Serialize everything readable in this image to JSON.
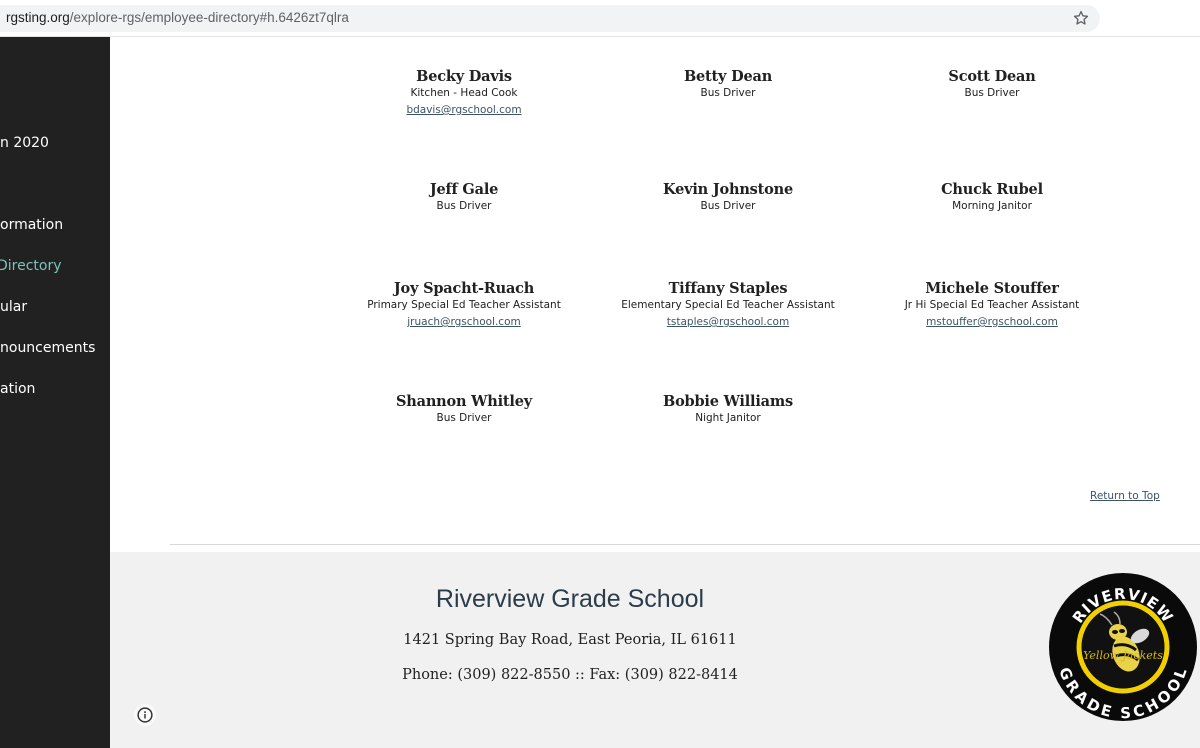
{
  "browser": {
    "url_host": "rgsting.org",
    "url_path": "/explore-rgs/employee-directory#h.6426zt7qlra",
    "bookmark_icon": "star-icon"
  },
  "sidebar": {
    "items": [
      {
        "label": "n 2020",
        "active": false
      },
      {
        "label": "ormation",
        "active": false
      },
      {
        "label": "Directory",
        "active": true
      },
      {
        "label": "ular",
        "active": false
      },
      {
        "label": "nouncements",
        "active": false
      },
      {
        "label": "ation",
        "active": false
      }
    ]
  },
  "directory": {
    "people": [
      {
        "name": "Becky Davis",
        "role": "Kitchen - Head Cook",
        "email": "bdavis@rgschool.com"
      },
      {
        "name": "Betty Dean",
        "role": "Bus Driver",
        "email": ""
      },
      {
        "name": "Scott Dean",
        "role": "Bus Driver",
        "email": ""
      },
      {
        "name": "Jeff Gale",
        "role": "Bus Driver",
        "email": ""
      },
      {
        "name": "Kevin Johnstone",
        "role": "Bus Driver",
        "email": ""
      },
      {
        "name": "Chuck Rubel",
        "role": "Morning Janitor",
        "email": ""
      },
      {
        "name": "Joy Spacht-Ruach",
        "role": "Primary Special Ed Teacher Assistant",
        "email": "jruach@rgschool.com"
      },
      {
        "name": "Tiffany Staples",
        "role": "Elementary Special Ed Teacher Assistant",
        "email": "tstaples@rgschool.com"
      },
      {
        "name": "Michele Stouffer",
        "role": "Jr Hi Special Ed Teacher Assistant",
        "email": "mstouffer@rgschool.com"
      },
      {
        "name": "Shannon Whitley",
        "role": "Bus Driver",
        "email": ""
      },
      {
        "name": "Bobbie Williams",
        "role": "Night Janitor",
        "email": ""
      }
    ],
    "return_to_top": "Return to Top"
  },
  "footer": {
    "title": "Riverview Grade School",
    "address": "1421 Spring Bay Road, East Peoria, IL 61611",
    "phone_line": "Phone: (309) 822-8550 :: Fax: (309) 822-8414",
    "logo": {
      "top_text": "RIVERVIEW",
      "bottom_text": "GRADE SCHOOL",
      "mascot_text": "Yellow Jackets"
    }
  },
  "colors": {
    "sidebar_bg": "#212121",
    "sidebar_active": "#7bc3bd",
    "link": "#3d5466",
    "footer_bg": "#f1f1f1",
    "footer_title": "#2b3d48",
    "logo_yellow": "#f2d000"
  }
}
